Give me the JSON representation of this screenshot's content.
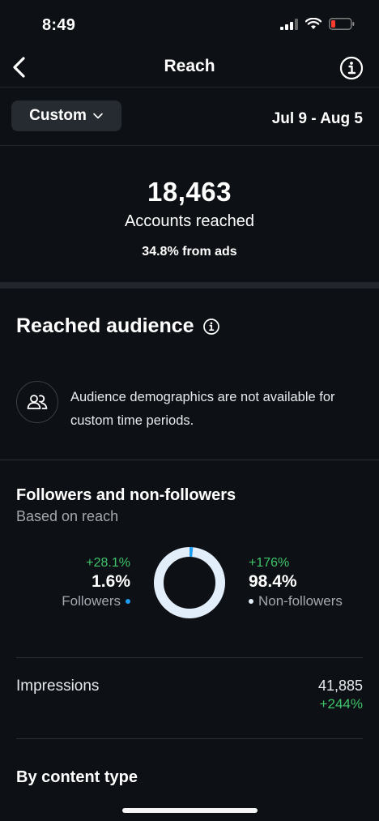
{
  "status_bar": {
    "time": "8:49"
  },
  "nav": {
    "title": "Reach"
  },
  "filter": {
    "period_label": "Custom",
    "date_range": "Jul 9 - Aug 5"
  },
  "summary": {
    "accounts_reached": "18,463",
    "accounts_reached_label": "Accounts reached",
    "from_ads": "34.8% from ads"
  },
  "reached_audience": {
    "title": "Reached audience",
    "notice": "Audience demographics are not available for custom time periods."
  },
  "followers_section": {
    "title": "Followers and non-followers",
    "subtitle": "Based on reach",
    "followers": {
      "change": "+28.1%",
      "percent": "1.6%",
      "label": "Followers",
      "value": 1.6
    },
    "non_followers": {
      "change": "+176%",
      "percent": "98.4%",
      "label": "Non-followers",
      "value": 98.4
    }
  },
  "impressions": {
    "label": "Impressions",
    "value": "41,885",
    "change": "+244%"
  },
  "content_type": {
    "title": "By content type"
  },
  "colors": {
    "background": "#0d1014",
    "followers": "#1d9bf0",
    "non_followers": "#e3eefb",
    "positive": "#3ec46a"
  }
}
